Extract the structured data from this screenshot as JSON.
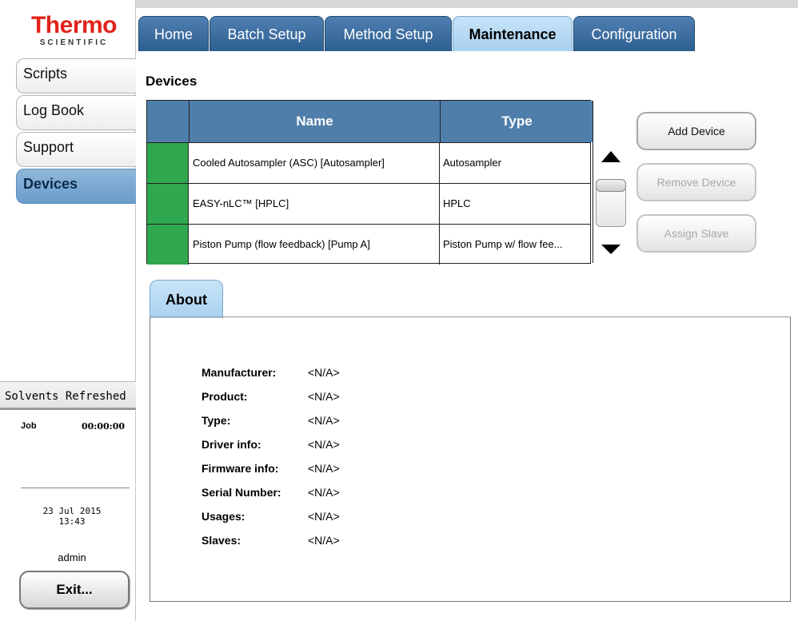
{
  "logo": {
    "brand": "Thermo",
    "sub": "SCIENTIFIC"
  },
  "sidebar": {
    "items": [
      {
        "label": "Scripts"
      },
      {
        "label": "Log Book"
      },
      {
        "label": "Support"
      },
      {
        "label": "Devices",
        "active": true
      }
    ]
  },
  "status": {
    "message": "Solvents Refreshed",
    "job_label": "Job",
    "job_time": "00:00:00",
    "date": "23 Jul 2015",
    "time": "13:43",
    "user": "admin",
    "exit_label": "Exit..."
  },
  "tabs": [
    {
      "label": "Home"
    },
    {
      "label": "Batch Setup"
    },
    {
      "label": "Method Setup"
    },
    {
      "label": "Maintenance",
      "active": true
    },
    {
      "label": "Configuration"
    }
  ],
  "devices": {
    "title": "Devices",
    "columns": {
      "name": "Name",
      "type": "Type"
    },
    "rows": [
      {
        "name": "Cooled Autosampler (ASC) [Autosampler]",
        "type": "Autosampler",
        "status_color": "#2fa84f"
      },
      {
        "name": "EASY-nLC™ [HPLC]",
        "type": "HPLC",
        "status_color": "#2fa84f"
      },
      {
        "name": "Piston Pump (flow feedback) [Pump A]",
        "type": "Piston Pump w/ flow fee...",
        "status_color": "#2fa84f"
      }
    ]
  },
  "actions": {
    "add": "Add Device",
    "remove": "Remove Device",
    "assign": "Assign Slave"
  },
  "about": {
    "tab_label": "About",
    "properties": [
      {
        "label": "Manufacturer:",
        "value": "<N/A>"
      },
      {
        "label": "Product:",
        "value": "<N/A>"
      },
      {
        "label": "Type:",
        "value": "<N/A>"
      },
      {
        "label": "Driver info:",
        "value": "<N/A>"
      },
      {
        "label": "Firmware info:",
        "value": "<N/A>"
      },
      {
        "label": "Serial Number:",
        "value": "<N/A>"
      },
      {
        "label": "Usages:",
        "value": "<N/A>"
      },
      {
        "label": "Slaves:",
        "value": "<N/A>"
      }
    ]
  },
  "colors": {
    "tab_blue": "#2e5f92",
    "tab_active": "#a9d1ef",
    "header_blue": "#4f7eab",
    "status_green": "#2fa84f",
    "brand_red": "#e2231a"
  }
}
